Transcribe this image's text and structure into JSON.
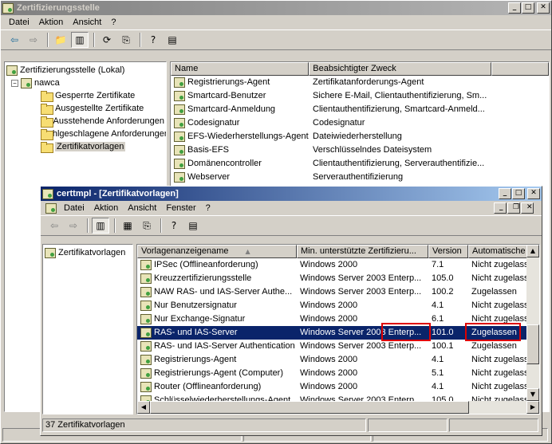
{
  "outer_window": {
    "title": "Zertifizierungsstelle",
    "menu": [
      "Datei",
      "Aktion",
      "Ansicht",
      "?"
    ],
    "tree": {
      "root": "Zertifizierungsstelle (Lokal)",
      "ca": "nawca",
      "children": [
        "Gesperrte Zertifikate",
        "Ausgestellte Zertifikate",
        "Ausstehende Anforderungen",
        "Fehlgeschlagene Anforderungen",
        "Zertifikatvorlagen"
      ]
    },
    "columns": [
      "Name",
      "Beabsichtigter Zweck"
    ],
    "rows": [
      {
        "name": "Registrierungs-Agent",
        "purpose": "Zertifikatanforderungs-Agent"
      },
      {
        "name": "Smartcard-Benutzer",
        "purpose": "Sichere E-Mail, Clientauthentifizierung, Sm..."
      },
      {
        "name": "Smartcard-Anmeldung",
        "purpose": "Clientauthentifizierung, Smartcard-Anmeld..."
      },
      {
        "name": "Codesignatur",
        "purpose": "Codesignatur"
      },
      {
        "name": "EFS-Wiederherstellungs-Agent",
        "purpose": "Dateiwiederherstellung"
      },
      {
        "name": "Basis-EFS",
        "purpose": "Verschlüsselndes Dateisystem"
      },
      {
        "name": "Domänencontroller",
        "purpose": "Clientauthentifizierung, Serverauthentifizie..."
      },
      {
        "name": "Webserver",
        "purpose": "Serverauthentifizierung"
      }
    ]
  },
  "inner_window": {
    "title": "certtmpl - [Zertifikatvorlagen]",
    "menu": [
      "Datei",
      "Aktion",
      "Ansicht",
      "Fenster",
      "?"
    ],
    "tree_item": "Zertifikatvorlagen",
    "columns": [
      "Vorlagenanzeigename",
      "Min. unterstützte Zertifizieru...",
      "Version",
      "Automatische R"
    ],
    "rows": [
      {
        "name": "IPSec (Offlineanforderung)",
        "min": "Windows 2000",
        "version": "7.1",
        "auto": "Nicht zugelassen"
      },
      {
        "name": "Kreuzzertifizierungsstelle",
        "min": "Windows Server 2003 Enterp...",
        "version": "105.0",
        "auto": "Nicht zugelassen"
      },
      {
        "name": "NAW RAS- und IAS-Server Authe...",
        "min": "Windows Server 2003 Enterp...",
        "version": "100.2",
        "auto": "Zugelassen"
      },
      {
        "name": "Nur Benutzersignatur",
        "min": "Windows 2000",
        "version": "4.1",
        "auto": "Nicht zugelassen"
      },
      {
        "name": "Nur Exchange-Signatur",
        "min": "Windows 2000",
        "version": "6.1",
        "auto": "Nicht zugelassen"
      },
      {
        "name": "RAS- und IAS-Server",
        "min": "Windows Server 2003 Enterp...",
        "version": "101.0",
        "auto": "Zugelassen",
        "selected": true
      },
      {
        "name": "RAS- und IAS-Server Authentication",
        "min": "Windows Server 2003 Enterp...",
        "version": "100.1",
        "auto": "Zugelassen"
      },
      {
        "name": "Registrierungs-Agent",
        "min": "Windows 2000",
        "version": "4.1",
        "auto": "Nicht zugelassen"
      },
      {
        "name": "Registrierungs-Agent (Computer)",
        "min": "Windows 2000",
        "version": "5.1",
        "auto": "Nicht zugelassen"
      },
      {
        "name": "Router (Offlineanforderung)",
        "min": "Windows 2000",
        "version": "4.1",
        "auto": "Nicht zugelassen"
      },
      {
        "name": "Schlüsselwiederherstellungs-Agent",
        "min": "Windows Server 2003 Enterp...",
        "version": "105.0",
        "auto": "Nicht zugelassen"
      }
    ],
    "status": "37 Zertifikatvorlagen"
  },
  "colors": {
    "highlight_box": "#e00000",
    "selection": "#0a246a"
  }
}
